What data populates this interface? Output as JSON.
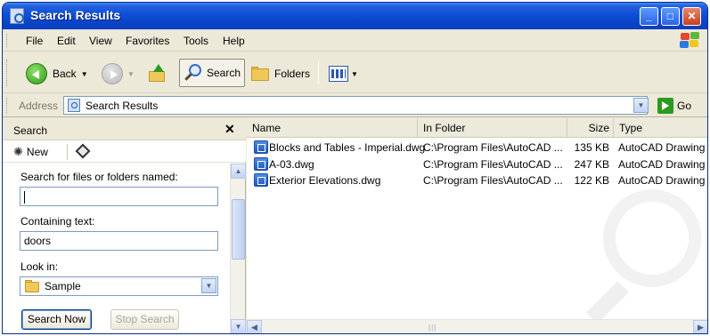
{
  "window": {
    "title": "Search Results",
    "controls": {
      "minimize": "_",
      "maximize": "□",
      "close": "✕"
    }
  },
  "menubar": {
    "items": [
      "File",
      "Edit",
      "View",
      "Favorites",
      "Tools",
      "Help"
    ]
  },
  "toolbar": {
    "back_label": "Back",
    "search_label": "Search",
    "folders_label": "Folders"
  },
  "address": {
    "label": "Address",
    "value": "Search Results",
    "go_label": "Go"
  },
  "search_pane": {
    "title": "Search",
    "close_glyph": "✕",
    "new_label": "New",
    "named_label": "Search for files or folders named:",
    "named_value": "",
    "containing_label": "Containing text:",
    "containing_value": "doors",
    "lookin_label": "Look in:",
    "lookin_value": "Sample",
    "search_now_label": "Search Now",
    "stop_search_label": "Stop Search"
  },
  "results": {
    "columns": [
      "Name",
      "In Folder",
      "Size",
      "Type"
    ],
    "rows": [
      {
        "name": "Blocks and Tables - Imperial.dwg",
        "folder": "C:\\Program Files\\AutoCAD ...",
        "size": "135 KB",
        "type": "AutoCAD Drawing"
      },
      {
        "name": "A-03.dwg",
        "folder": "C:\\Program Files\\AutoCAD ...",
        "size": "247 KB",
        "type": "AutoCAD Drawing"
      },
      {
        "name": "Exterior Elevations.dwg",
        "folder": "C:\\Program Files\\AutoCAD ...",
        "size": "122 KB",
        "type": "AutoCAD Drawing"
      }
    ]
  },
  "icons": {
    "title": "search-results-icon",
    "back": "back-arrow-icon",
    "forward": "forward-arrow-icon",
    "up": "folder-up-icon",
    "search": "magnifier-icon",
    "folders": "folder-icon",
    "views": "views-icon",
    "file": "dwg-file-icon",
    "go": "go-arrow-icon"
  },
  "colors": {
    "titlebar": "#0a45c8",
    "chrome": "#ece9d8",
    "go_green": "#2c9a1d",
    "close_red": "#c6401f"
  }
}
